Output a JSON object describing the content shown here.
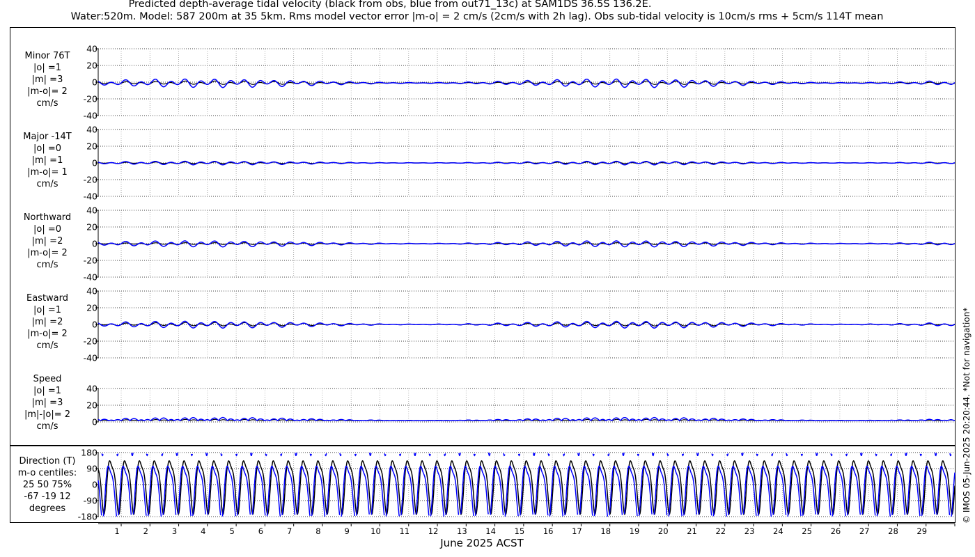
{
  "title_line1": "Predicted depth-average tidal velocity (black from obs, blue from out71_13c) at SAM1DS 36.5S 136.2E.",
  "title_line2": "Water:520m. Model: 587 200m at 35 5km. Rms model vector error |m-o| = 2 cm/s (2cm/s with 2h lag). Obs sub-tidal velocity is 10cm/s rms + 5cm/s 114T mean",
  "credit": "© IMOS 05-Jun-2025 20:20:44. *Not for navigation*",
  "colors": {
    "obs": "#000000",
    "model": "#0000ff",
    "grid": "#999999"
  },
  "chart_data": [
    {
      "type": "line",
      "panel": "minor",
      "label_lines": [
        "Minor 76T",
        "|o| =1",
        "|m| =3",
        "|m-o|= 2",
        "cm/s"
      ],
      "ylim": [
        -40,
        40
      ],
      "yticks": [
        "40",
        "20",
        "0",
        "-20",
        "-40"
      ],
      "ytick_values": [
        40,
        20,
        0,
        -20,
        -40
      ],
      "obs_amp": 1.5,
      "model_amp": 3.5,
      "mean": -1,
      "series": [
        {
          "color": "#000000",
          "amplitude": 1.5,
          "offset": -1
        },
        {
          "color": "#0000ff",
          "amplitude": 3.5,
          "offset": -1
        }
      ]
    },
    {
      "type": "line",
      "panel": "major",
      "label_lines": [
        "Major -14T",
        "|o| =0",
        "|m| =1",
        "|m-o|= 1",
        "cm/s"
      ],
      "ylim": [
        -40,
        40
      ],
      "yticks": [
        "40",
        "20",
        "0",
        "-20",
        "-40"
      ],
      "ytick_values": [
        40,
        20,
        0,
        -20,
        -40
      ],
      "obs_amp": 0.8,
      "model_amp": 1.5,
      "mean": 0,
      "series": [
        {
          "color": "#000000",
          "amplitude": 0.8,
          "offset": 0
        },
        {
          "color": "#0000ff",
          "amplitude": 1.5,
          "offset": 0
        }
      ]
    },
    {
      "type": "line",
      "panel": "northward",
      "label_lines": [
        "Northward",
        "|o| =0",
        "|m| =2",
        "|m-o|= 2",
        "cm/s"
      ],
      "ylim": [
        -40,
        40
      ],
      "yticks": [
        "40",
        "20",
        "0",
        "-20",
        "-40"
      ],
      "ytick_values": [
        40,
        20,
        0,
        -20,
        -40
      ],
      "obs_amp": 0.8,
      "model_amp": 2.5,
      "mean": 0,
      "series": [
        {
          "color": "#000000",
          "amplitude": 0.8,
          "offset": 0
        },
        {
          "color": "#0000ff",
          "amplitude": 2.5,
          "offset": 0
        }
      ]
    },
    {
      "type": "line",
      "panel": "eastward",
      "label_lines": [
        "Eastward",
        "|o| =1",
        "|m| =2",
        "|m-o|= 2",
        "cm/s"
      ],
      "ylim": [
        -40,
        40
      ],
      "yticks": [
        "40",
        "20",
        "0",
        "-20",
        "-40"
      ],
      "ytick_values": [
        40,
        20,
        0,
        -20,
        -40
      ],
      "obs_amp": 1.5,
      "model_amp": 2.8,
      "mean": 0,
      "series": [
        {
          "color": "#000000",
          "amplitude": 1.5,
          "offset": 0
        },
        {
          "color": "#0000ff",
          "amplitude": 2.8,
          "offset": 0
        }
      ]
    },
    {
      "type": "line",
      "panel": "speed",
      "label_lines": [
        "Speed",
        "|o| =1",
        "|m| =3",
        "|m|-|o|= 2",
        "cm/s"
      ],
      "ylim": [
        0,
        40
      ],
      "yticks": [
        "40",
        "20",
        "0"
      ],
      "ytick_values": [
        40,
        20,
        0
      ],
      "obs_amp": 1.0,
      "model_amp": 2.5,
      "mean": 1.5,
      "series": [
        {
          "color": "#000000",
          "amplitude": 1.0,
          "offset": 1.5
        },
        {
          "color": "#0000ff",
          "amplitude": 2.5,
          "offset": 1.5
        }
      ]
    },
    {
      "type": "line",
      "panel": "direction",
      "label_lines": [
        "Direction (T)",
        "m-o centiles:",
        "25  50  75%",
        "-67  -19  12",
        "degrees"
      ],
      "ylim": [
        -180,
        180
      ],
      "yticks": [
        "180",
        "90",
        "0",
        "-90",
        "-180"
      ],
      "ytick_values": [
        180,
        90,
        0,
        -90,
        -180
      ],
      "series": [
        {
          "name": "obs direction",
          "color": "#000000"
        },
        {
          "name": "model direction",
          "color": "#0000ff"
        }
      ]
    }
  ],
  "x_axis": {
    "label": "June 2025 ACST",
    "tick_labels": [
      "1",
      "2",
      "3",
      "4",
      "5",
      "6",
      "7",
      "8",
      "9",
      "10",
      "11",
      "12",
      "13",
      "14",
      "15",
      "16",
      "17",
      "18",
      "19",
      "20",
      "21",
      "22",
      "23",
      "24",
      "25",
      "26",
      "27",
      "28",
      "29"
    ],
    "day_start": 0.2,
    "day_end": 30.0
  }
}
